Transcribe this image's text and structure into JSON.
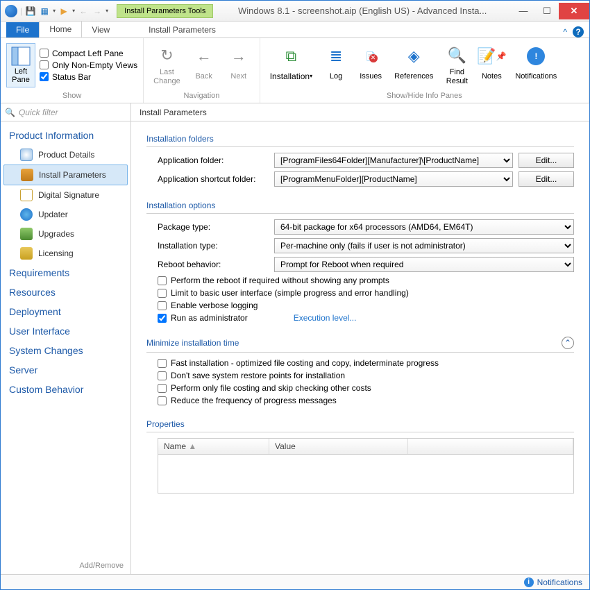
{
  "titlebar": {
    "tool_tab": "Install Parameters Tools",
    "title": "Windows 8.1 - screenshot.aip (English US) - Advanced Insta..."
  },
  "tabs": {
    "file": "File",
    "home": "Home",
    "view": "View",
    "context": "Install Parameters"
  },
  "ribbon": {
    "leftpane": "Left\nPane",
    "checks": {
      "compact": "Compact Left Pane",
      "nonempty": "Only Non-Empty Views",
      "status": "Status Bar"
    },
    "group_show": "Show",
    "nav": {
      "last": "Last\nChange",
      "back": "Back",
      "next": "Next"
    },
    "group_nav": "Navigation",
    "panes": {
      "installation": "Installation",
      "log": "Log",
      "issues": "Issues",
      "references": "References",
      "find": "Find\nResult",
      "notes": "Notes",
      "notifications": "Notifications"
    },
    "group_panes": "Show/Hide Info Panes"
  },
  "filter_placeholder": "Quick filter",
  "sidebar": {
    "product_info": "Product Information",
    "items": [
      {
        "label": "Product Details"
      },
      {
        "label": "Install Parameters"
      },
      {
        "label": "Digital Signature"
      },
      {
        "label": "Updater"
      },
      {
        "label": "Upgrades"
      },
      {
        "label": "Licensing"
      }
    ],
    "sections": [
      "Requirements",
      "Resources",
      "Deployment",
      "User Interface",
      "System Changes",
      "Server",
      "Custom Behavior"
    ],
    "footer": "Add/Remove"
  },
  "content": {
    "header": "Install Parameters",
    "sec_folders": "Installation folders",
    "app_folder_lbl": "Application folder:",
    "app_folder_val": "[ProgramFiles64Folder][Manufacturer]\\[ProductName]",
    "shortcut_lbl": "Application shortcut folder:",
    "shortcut_val": "[ProgramMenuFolder][ProductName]",
    "edit_btn": "Edit...",
    "sec_options": "Installation options",
    "pkg_lbl": "Package type:",
    "pkg_val": "64-bit package for x64 processors (AMD64, EM64T)",
    "inst_lbl": "Installation type:",
    "inst_val": "Per-machine only (fails if user is not administrator)",
    "reboot_lbl": "Reboot behavior:",
    "reboot_val": "Prompt for Reboot when required",
    "chk_reboot": "Perform the reboot if required without showing any prompts",
    "chk_limit": "Limit to basic user interface (simple progress and error handling)",
    "chk_verbose": "Enable verbose logging",
    "chk_admin": "Run as administrator",
    "exec_link": "Execution level...",
    "sec_min": "Minimize installation time",
    "chk_fast": "Fast installation - optimized file costing and copy, indeterminate progress",
    "chk_restore": "Don't save system restore points for installation",
    "chk_costing": "Perform only file costing and skip checking other costs",
    "chk_reduce": "Reduce the frequency of progress messages",
    "sec_props": "Properties",
    "col_name": "Name",
    "col_value": "Value"
  },
  "statusbar": {
    "notifications": "Notifications"
  }
}
